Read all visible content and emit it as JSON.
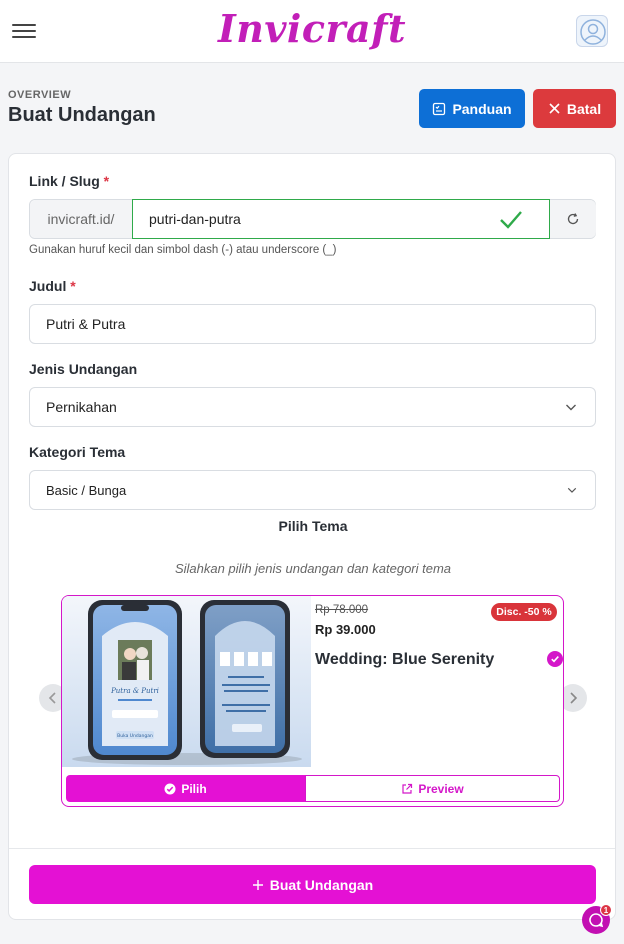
{
  "header": {
    "brand": "Invicraft"
  },
  "page": {
    "overline": "OVERVIEW",
    "title": "Buat Undangan",
    "panduan_label": "Panduan",
    "batal_label": "Batal"
  },
  "form": {
    "slug": {
      "label": "Link / Slug",
      "required_mark": "*",
      "prefix": "invicraft.id/",
      "value": "putri-dan-putra",
      "help": "Gunakan huruf kecil dan simbol dash (-) atau underscore (_)"
    },
    "judul": {
      "label": "Judul",
      "required_mark": "*",
      "value": "Putri & Putra"
    },
    "jenis": {
      "label": "Jenis Undangan",
      "value": "Pernikahan"
    },
    "kategori": {
      "label": "Kategori Tema",
      "value": "Basic / Bunga"
    },
    "pilih_tema_label": "Pilih Tema",
    "tema_hint": "Silahkan pilih jenis undangan dan kategori tema",
    "submit_label": "Buat Undangan"
  },
  "theme_card": {
    "old_price": "Rp 78.000",
    "new_price": "Rp 39.000",
    "discount": "Disc. -50 %",
    "name": "Wedding: Blue Serenity",
    "pilih_label": "Pilih",
    "preview_label": "Preview",
    "selected": true,
    "mockup_front_names": "Putra & Putri",
    "mockup_open_button": "Buka Undangan"
  },
  "chat": {
    "unread": "1"
  },
  "colors": {
    "brand": "#c21fb8",
    "accent": "#e411d4",
    "primary": "#0d6fd6",
    "danger": "#dc3a3d",
    "success": "#2faa4a"
  },
  "icons": {
    "menu": "hamburger-icon",
    "user": "user-avatar-icon",
    "panduan": "checklist-icon",
    "batal": "close-icon",
    "valid": "check-icon",
    "refresh": "refresh-icon",
    "dropdown": "chevron-down-icon",
    "prev": "chevron-left-icon",
    "next": "chevron-right-icon",
    "pilih": "check-circle-icon",
    "preview": "external-link-icon",
    "create": "plus-icon",
    "chat": "chat-icon"
  }
}
